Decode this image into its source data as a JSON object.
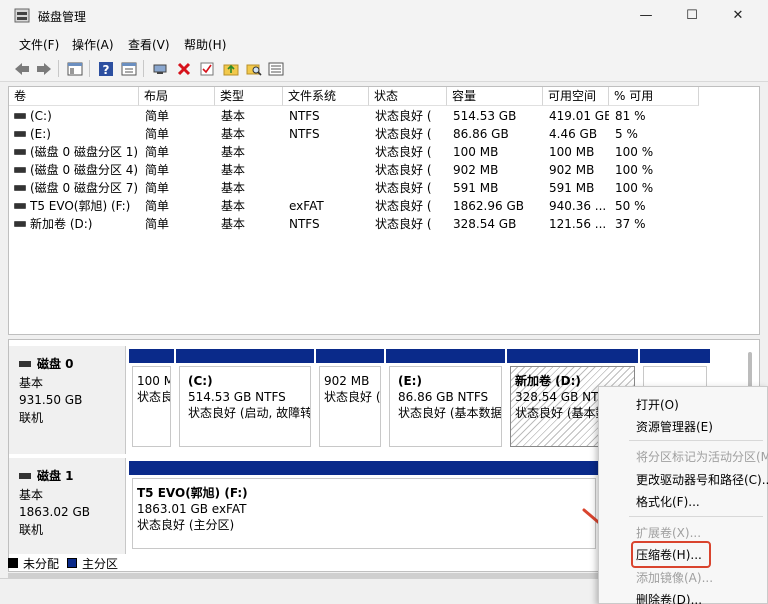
{
  "window": {
    "title": "磁盘管理",
    "min_glyph": "—",
    "max_glyph": "☐",
    "close_glyph": "✕"
  },
  "menu": [
    "文件(F)",
    "操作(A)",
    "查看(V)",
    "帮助(H)"
  ],
  "toolbar_icons": [
    "back-arrow-icon",
    "forward-arrow-icon",
    "console-tree-icon",
    "help-icon",
    "properties-icon",
    "connect-icon",
    "delete-icon",
    "check-icon",
    "upload-folder-icon",
    "search-folder-icon",
    "list-view-icon"
  ],
  "volume_table": {
    "headers": [
      "卷",
      "布局",
      "类型",
      "文件系统",
      "状态",
      "容量",
      "可用空间",
      "% 可用"
    ],
    "rows": [
      [
        "(C:)",
        "简单",
        "基本",
        "NTFS",
        "状态良好 (",
        "514.53 GB",
        "419.01 GB",
        "81 %"
      ],
      [
        "(E:)",
        "简单",
        "基本",
        "NTFS",
        "状态良好 (",
        "86.86 GB",
        "4.46 GB",
        "5 %"
      ],
      [
        "(磁盘 0 磁盘分区 1)",
        "简单",
        "基本",
        "",
        "状态良好 (",
        "100 MB",
        "100 MB",
        "100 %"
      ],
      [
        "(磁盘 0 磁盘分区 4)",
        "简单",
        "基本",
        "",
        "状态良好 (",
        "902 MB",
        "902 MB",
        "100 %"
      ],
      [
        "(磁盘 0 磁盘分区 7)",
        "简单",
        "基本",
        "",
        "状态良好 (",
        "591 MB",
        "591 MB",
        "100 %"
      ],
      [
        "T5 EVO(郭旭) (F:)",
        "简单",
        "基本",
        "exFAT",
        "状态良好 (",
        "1862.96 GB",
        "940.36 ...",
        "50 %"
      ],
      [
        "新加卷 (D:)",
        "简单",
        "基本",
        "NTFS",
        "状态良好 (",
        "328.54 GB",
        "121.56 ...",
        "37 %"
      ]
    ]
  },
  "disks": [
    {
      "name": "磁盘 0",
      "type": "基本",
      "size": "931.50 GB",
      "status": "联机",
      "partitions": [
        {
          "title": "",
          "line1": "100 M",
          "line2": "状态良"
        },
        {
          "title": "(C:)",
          "line1": "514.53 GB NTFS",
          "line2": "状态良好 (启动, 故障转"
        },
        {
          "title": "",
          "line1": "902 MB",
          "line2": "状态良好 ("
        },
        {
          "title": "(E:)",
          "line1": "86.86 GB NTFS",
          "line2": "状态良好 (基本数据"
        },
        {
          "title": "新加卷  (D:)",
          "line1": "328.54 GB NTF",
          "line2": "状态良好 (基本数"
        },
        {
          "title": "",
          "line1": "",
          "line2": ""
        }
      ]
    },
    {
      "name": "磁盘 1",
      "type": "基本",
      "size": "1863.02 GB",
      "status": "联机",
      "partitions": [
        {
          "title": "T5 EVO(郭旭)  (F:)",
          "line1": "1863.01 GB exFAT",
          "line2": "状态良好 (主分区)"
        }
      ]
    }
  ],
  "legend": [
    {
      "label": "未分配",
      "color": "#000000"
    },
    {
      "label": "主分区",
      "color": "#0a2a8a"
    }
  ],
  "context_menu": {
    "items": [
      {
        "label": "打开(O)",
        "enabled": true
      },
      {
        "label": "资源管理器(E)",
        "enabled": true
      },
      {
        "label": "将分区标记为活动分区(M",
        "enabled": false
      },
      {
        "label": "更改驱动器号和路径(C)...",
        "enabled": true
      },
      {
        "label": "格式化(F)...",
        "enabled": true
      },
      {
        "label": "扩展卷(X)...",
        "enabled": false
      },
      {
        "label": "压缩卷(H)...",
        "enabled": true
      },
      {
        "label": "添加镜像(A)...",
        "enabled": false
      },
      {
        "label": "删除卷(D)...",
        "enabled": true
      }
    ],
    "highlighted": "压缩卷(H)..."
  },
  "colors": {
    "primary_partition": "#0a2a8a",
    "annotation": "#d9442e"
  }
}
